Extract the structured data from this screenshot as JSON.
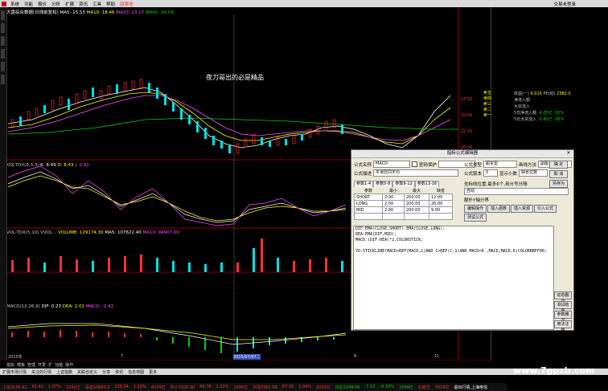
{
  "menubar": {
    "items": [
      "系统",
      "功能",
      "报价",
      "分析",
      "扩展",
      "资讯",
      "工具",
      "帮助"
    ],
    "highlight": "股票池",
    "right": "交易未登录"
  },
  "main_header": {
    "label": "大盘综合数据(日线前复权)",
    "ma5": "MA5: 15.53",
    "ma10": "MA10: 18.46",
    "ma20": "MA20: 23.17",
    "ma60": "MA60: 24.59"
  },
  "overlay_text": "夜刀哥出的必是精品",
  "kdj_header": {
    "label": "KDJ-TDX(9,3,3)",
    "k": "K: 8.49",
    "d": "D: 8.43",
    "j": "J: 2.92"
  },
  "vol_header": {
    "label": "VOL-TDX(5,10)",
    "vvol": "VVOL: -",
    "volume": "VOLUME: 129174.30",
    "ma5": "MA5: 107622.40",
    "ma10": "MA10: 94907.00"
  },
  "macd_header": {
    "label": "MACD(12,26,9)",
    "dif": "DIF: 0.23",
    "dea": "DEA: 2.01",
    "macd": "MACD: -2.43"
  },
  "price_axis": [
    "27.50",
    "25.00",
    "22.50",
    "20.00"
  ],
  "date_labels": [
    "2015年",
    "7",
    "2015/07/07二",
    "8",
    "11"
  ],
  "right_panel": {
    "stats": [
      {
        "label": "收益(一)",
        "value": "0.015"
      },
      {
        "label": "PE(动)",
        "value": "2382.0"
      },
      {
        "label": "净流入额",
        "value": ""
      },
      {
        "label": "大宗流入",
        "value": ""
      },
      {
        "label": "5日净流入额",
        "value": "-4.05亿"
      },
      {
        "label": "5日大宗流入",
        "value": "-3.81亿"
      }
    ],
    "percents": [
      "-30%",
      "-28%"
    ],
    "order_labels": [
      "卖五",
      "卖四",
      "卖三",
      "卖二",
      "卖一"
    ]
  },
  "dialog": {
    "title": "指标公式编辑器",
    "name_label": "公式名称",
    "name_value": "MACD",
    "password_label": "密码保护",
    "desc_label": "公式描述",
    "desc_value": "平滑异同平均",
    "type_label": "公式类型",
    "type_value": "超买型",
    "draw_label": "画线方法",
    "draw_value": "副图",
    "version_label": "公式版本",
    "version_value": "0",
    "decimal_label": "显示小数",
    "decimal_value": "缺省位数",
    "tabs": [
      "参数1-4",
      "参数5-8",
      "参数9-12",
      "参数13-16"
    ],
    "param_headers": [
      "参数",
      "最小",
      "最大",
      "缺省"
    ],
    "params": [
      [
        "SHORT",
        "2.00",
        "200.00",
        "12.00"
      ],
      [
        "LONG",
        "2.00",
        "200.00",
        "26.00"
      ],
      [
        "MID",
        "2.00",
        "200.00",
        "9.00"
      ],
      [
        "",
        "",
        "",
        ""
      ]
    ],
    "coord_label": "坐标线位置,最多6个,用分号分隔",
    "coord_value": "自动",
    "extra_label": "额外Y轴分界",
    "buttons_right": [
      "确 定",
      "取 消",
      "另存为"
    ],
    "buttons_mid": [
      "编辑操作",
      "插入函数",
      "插入资源",
      "引入公式",
      "测试公式"
    ],
    "code": [
      "DIF:EMA(CLOSE,SHORT)-EMA(CLOSE,LONG);",
      "DEA:EMA(DIF,MID);",
      "MACD:(DIF-DEA)*2,COLORSTICK;",
      "",
      "YD:STICKLINE(MACD>REF(MACD,1)AND C>REF(C,1)AND MACD<0 ,MACD,MACD,0)COLORBBFF00;"
    ],
    "side_buttons": [
      "动态翻译",
      "测试结果",
      "参数精灵",
      "用法注释"
    ]
  },
  "bottom_tabs": [
    "指标",
    "模板",
    "管理",
    "开发",
    "扩",
    "功能",
    "操作"
  ],
  "status_line1": {
    "items": [
      "扩展市场行情",
      "关注的行情",
      "上证指数",
      "关联自定义",
      "分享",
      "资讯",
      "信息地图",
      "更多"
    ]
  },
  "status_line2": {
    "items": [
      "上证3156.41",
      "61.41",
      "1.97%",
      "3242亿",
      "深证10880.9",
      "128.54",
      "1.20%",
      "4374亿",
      "中小7200.30",
      "86.78",
      "1.22%",
      "1095亿",
      "沪深3361.56",
      "67.18",
      "2.04%",
      "2035亿",
      "创业2249.99",
      "-7.53",
      "-0.33%",
      "1088亿",
      "北成交",
      "7616亿",
      "退出行情,上海电信"
    ]
  },
  "watermark": "www.7gpzb.com"
}
